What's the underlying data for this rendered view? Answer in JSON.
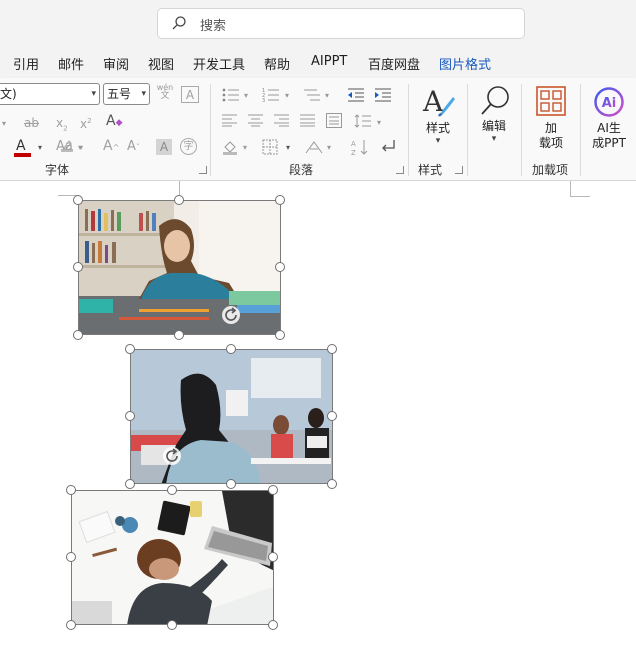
{
  "search": {
    "placeholder": "搜索"
  },
  "tabs": [
    {
      "label": "引用"
    },
    {
      "label": "邮件"
    },
    {
      "label": "审阅"
    },
    {
      "label": "视图"
    },
    {
      "label": "开发工具"
    },
    {
      "label": "帮助"
    },
    {
      "label": "AIPPT"
    },
    {
      "label": "百度网盘"
    },
    {
      "label": "图片格式"
    }
  ],
  "active_tab": "图片格式",
  "font_group": {
    "font_name": "文)",
    "font_size": "五号",
    "label": "字体",
    "phonetic_top": "wén",
    "phonetic_bottom": "文",
    "char_border": "A",
    "clear_format": "A",
    "strikethrough": "ab",
    "subscript": "x",
    "subscript_mark": "2",
    "superscript": "x",
    "superscript_mark": "2",
    "font_color": "A",
    "grow_font": "A",
    "shrink_font": "A",
    "change_case": "Aa",
    "char_shading": "A",
    "enclose_char": "字"
  },
  "paragraph_group": {
    "label": "段落"
  },
  "styles_group": {
    "button_label": "样式",
    "label": "样式"
  },
  "edit_group": {
    "button_label": "编辑"
  },
  "addins_group": {
    "button_line1": "加",
    "button_line2": "载项",
    "label": "加载项"
  },
  "aippt_group": {
    "button_line1": "AI生",
    "button_line2": "成PPT",
    "logo_text": "Ai"
  },
  "colors": {
    "accent": "#185abd",
    "font_color_bar": "#c00000",
    "addins_icon": "#c8552a",
    "ai_logo_start": "#3c5cf0",
    "ai_logo_end": "#d34cc9"
  },
  "document": {
    "images": [
      {
        "name": "girl-drawing-at-desk-photo",
        "selected": true
      },
      {
        "name": "kids-in-classroom-photo",
        "selected": true
      },
      {
        "name": "boy-studying-with-laptop-photo",
        "selected": true
      }
    ]
  }
}
